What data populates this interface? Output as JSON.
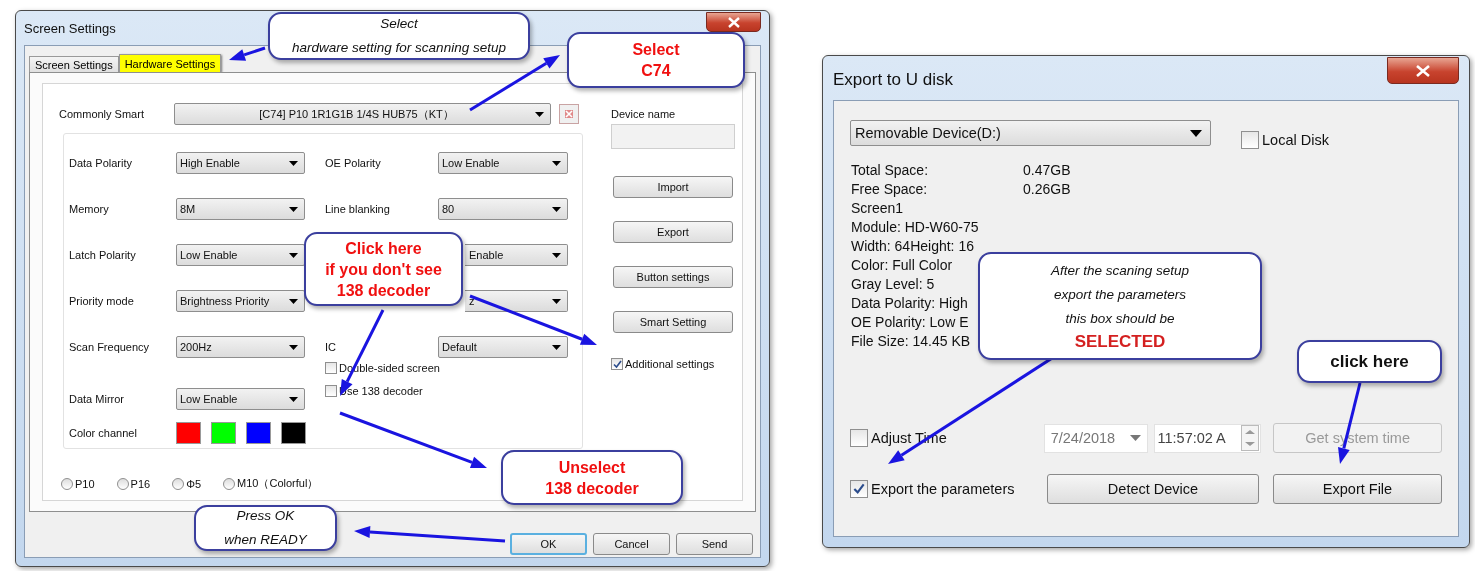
{
  "screen_settings_dialog": {
    "title": "Screen Settings",
    "tabs": [
      {
        "label": "Screen Settings",
        "selected": false
      },
      {
        "label": "Hardware Settings",
        "selected": true
      }
    ],
    "commonly_smart": {
      "label": "Commonly Smart",
      "value": "[C74]  P10 1R1G1B 1/4S HUB75（KT）"
    },
    "parameters": [
      {
        "label": "Data Polarity",
        "value": "High Enable",
        "right_label": "OE Polarity",
        "right_value": "Low Enable"
      },
      {
        "label": "Memory",
        "value": "8M",
        "right_label": "Line blanking",
        "right_value": "80"
      },
      {
        "label": "Latch Polarity",
        "value": "Low Enable",
        "right_value": "Enable"
      },
      {
        "label": "Priority mode",
        "value": "Brightness Priority",
        "right_value": "z"
      },
      {
        "label": "Scan Frequency",
        "value": "200Hz",
        "right_label": "IC",
        "right_value": "Default"
      }
    ],
    "checkboxes": [
      {
        "label": "Double-sided screen",
        "checked": false
      },
      {
        "label": "Use 138 decoder",
        "checked": false
      }
    ],
    "data_mirror": {
      "label": "Data Mirror",
      "value": "Low Enable"
    },
    "color_channel": {
      "label": "Color channel",
      "swatches": [
        {
          "color": "#ff0000"
        },
        {
          "color": "#00ff00"
        },
        {
          "color": "#0000ff"
        },
        {
          "color": "#000000"
        }
      ]
    },
    "radios": [
      {
        "label": "P10",
        "selected": false
      },
      {
        "label": "P16",
        "selected": false
      },
      {
        "label": "Φ5",
        "selected": false
      },
      {
        "label": "M10（Colorful）",
        "selected": false
      }
    ],
    "device_name": {
      "label": "Device name"
    },
    "side_buttons": [
      "Import",
      "Export",
      "Button settings",
      "Smart Setting"
    ],
    "additional_settings": {
      "label": "Additional settings",
      "checked": true
    },
    "buttons": [
      {
        "label": "OK",
        "default": true
      },
      {
        "label": "Cancel",
        "default": false
      },
      {
        "label": "Send",
        "default": false
      }
    ]
  },
  "export_dialog": {
    "title": "Export to U disk",
    "device": {
      "value": "Removable Device(D:)"
    },
    "local_disk": {
      "label": "Local Disk",
      "checked": false
    },
    "info": [
      {
        "label": "Total Space:",
        "value": "0.47GB"
      },
      {
        "label": "Free Space:",
        "value": "0.26GB"
      },
      {
        "label": "Screen1"
      },
      {
        "label": "Module: HD-W60-75"
      },
      {
        "label": "Width: 64Height: 16"
      },
      {
        "label": "Color: Full Color"
      },
      {
        "label": "Gray Level: 5"
      },
      {
        "label": "Data Polarity: High"
      },
      {
        "label": "OE Polarity: Low E"
      },
      {
        "label": "File Size: 14.45 KB"
      }
    ],
    "adjust_time": {
      "label": "Adjust Time",
      "checked": false
    },
    "date": "7/24/2018",
    "time": "11:57:02 A",
    "get_time": {
      "label": "Get system time",
      "disabled": true
    },
    "export_parameters": {
      "label": "Export the parameters",
      "checked": true
    },
    "buttons": [
      "Detect Device",
      "Export File"
    ]
  },
  "callouts": [
    {
      "kind": "note",
      "lines": [
        "Select",
        "hardware setting for scanning setup"
      ]
    },
    {
      "kind": "alert",
      "lines": [
        "Select",
        "C74"
      ]
    },
    {
      "kind": "alert",
      "lines": [
        "Click here",
        "if you don't see",
        "138 decoder"
      ]
    },
    {
      "kind": "alert",
      "lines": [
        "Unselect",
        "138 decoder"
      ]
    },
    {
      "kind": "note",
      "lines": [
        "Press OK",
        "when READY"
      ]
    },
    {
      "kind": "note",
      "lines": [
        "After the scaning setup",
        "export the parameters",
        "this box should be"
      ],
      "emphasis": "SELECTED"
    },
    {
      "kind": "action",
      "lines": [
        "click here"
      ]
    }
  ]
}
